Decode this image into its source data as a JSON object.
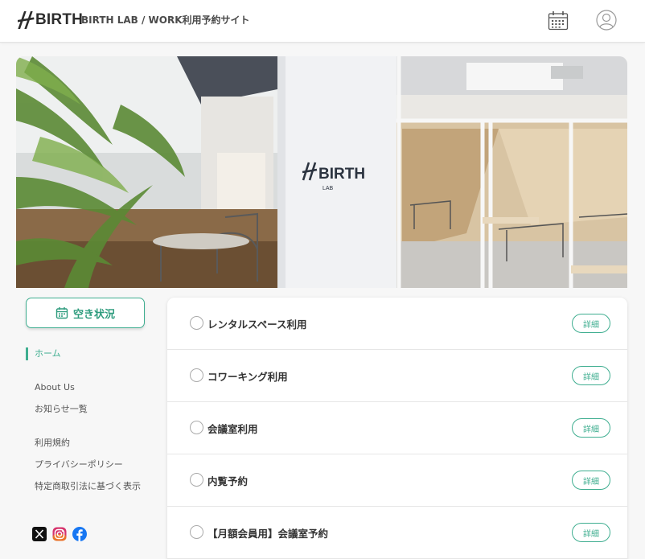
{
  "header": {
    "logo_text": "BIRTH",
    "site_title": "BIRTH LAB / WORK利用予約サイト",
    "calendar_icon": "calendar-icon",
    "user_icon": "user-icon"
  },
  "hero": {
    "sign_text": "BIRTH",
    "sign_sub": "LAB"
  },
  "sidebar": {
    "availability_label": "空き状況",
    "availability_icon": "calendar-icon",
    "home": "ホーム",
    "links": [
      "About Us",
      "お知らせ一覧",
      "利用規約",
      "プライバシーポリシー",
      "特定商取引法に基づく表示"
    ],
    "social": [
      "x-icon",
      "instagram-icon",
      "facebook-icon"
    ]
  },
  "services": [
    {
      "label": "レンタルスペース利用",
      "detail": "詳細"
    },
    {
      "label": "コワーキング利用",
      "detail": "詳細"
    },
    {
      "label": "会議室利用",
      "detail": "詳細"
    },
    {
      "label": "内覧予約",
      "detail": "詳細"
    },
    {
      "label": "【月額会員用】会議室予約",
      "detail": "詳細"
    }
  ],
  "colors": {
    "accent": "#3fae90",
    "background": "#f7f7f7",
    "text": "#333333"
  }
}
